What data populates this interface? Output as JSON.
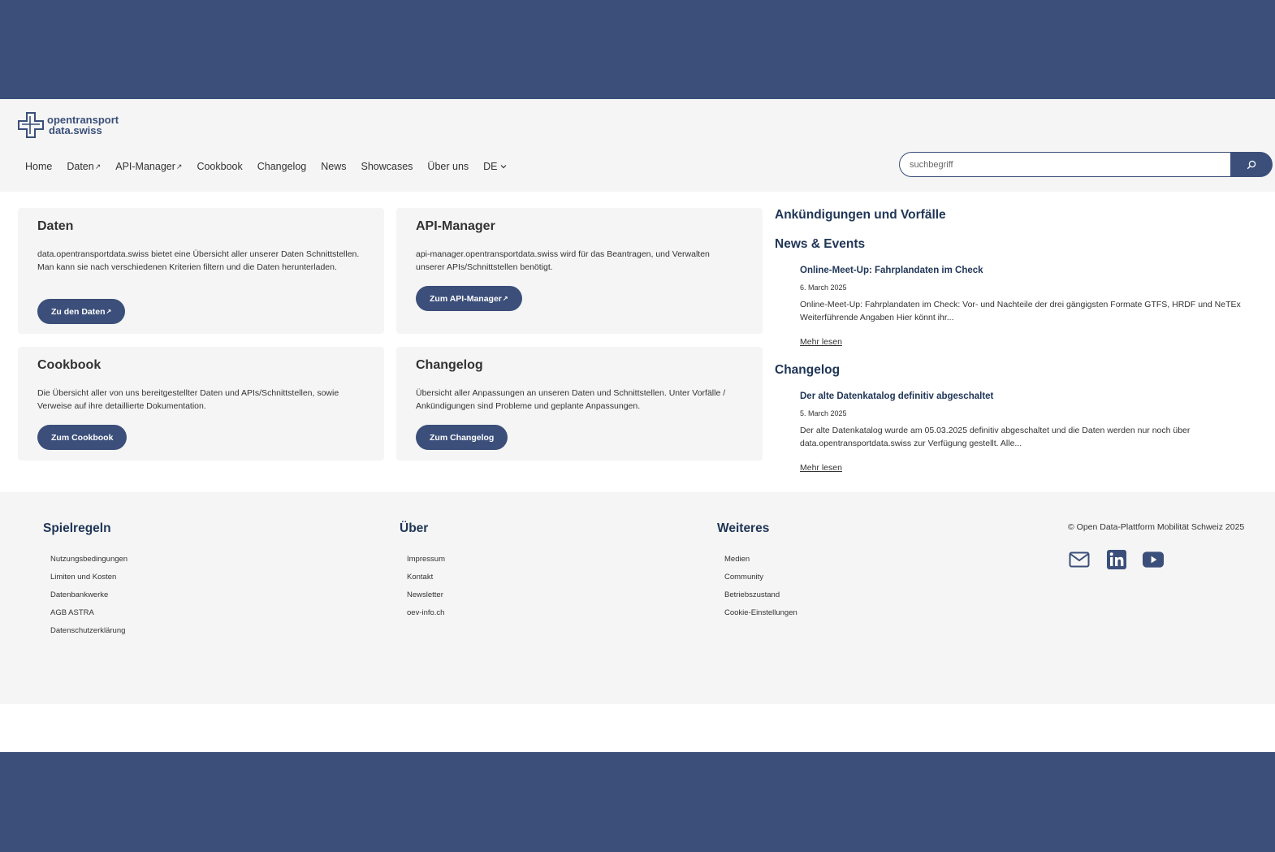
{
  "brand": {
    "logo_line1": "opentransport",
    "logo_line2": "data.swiss"
  },
  "nav": {
    "items": [
      {
        "label": "Home"
      },
      {
        "label": "Daten",
        "external": true
      },
      {
        "label": "API-Manager",
        "external": true
      },
      {
        "label": "Cookbook"
      },
      {
        "label": "Changelog"
      },
      {
        "label": "News"
      },
      {
        "label": "Showcases"
      },
      {
        "label": "Über uns"
      }
    ],
    "language": "DE",
    "external_glyph": "↗",
    "chevron_glyph": "⌄"
  },
  "search": {
    "placeholder": "suchbegriff",
    "button_icon": "search-icon"
  },
  "cards": [
    {
      "title": "Daten",
      "text": "data.opentransportdata.swiss bietet eine Übersicht aller unserer Daten Schnittstellen. Man kann sie nach verschiedenen Kriterien filtern und die Daten herunterladen.",
      "button": "Zu den Daten"
    },
    {
      "title": "API-Manager",
      "text": "api-manager.opentransportdata.swiss wird für das Beantragen, und Verwalten unserer APIs/Schnittstellen benötigt.",
      "button": "Zum API-Manager"
    },
    {
      "title": "Cookbook",
      "text": "Die Übersicht aller von uns bereitgestellter Daten und APIs/Schnittstellen, sowie Verweise auf ihre detaillierte Dokumentation.",
      "button": "Zum Cookbook"
    },
    {
      "title": "Changelog",
      "text": "Übersicht aller Anpassungen an unseren Daten und Schnittstellen. Unter Vorfälle / Ankündigungen sind Probleme und geplante Anpassungen.",
      "button": "Zum Changelog"
    }
  ],
  "sidebar": {
    "announcements_heading": "Ankündigungen und Vorfälle",
    "news_heading": "News & Events",
    "news_item": {
      "title": "Online-Meet-Up: Fahrplandaten im Check",
      "date": "6. March 2025",
      "text": "Online-Meet-Up: Fahrplandaten im Check: Vor- und Nachteile der drei gängigsten Formate GTFS, HRDF und NeTEx Weiterführende Angaben Hier könnt ihr...",
      "more": "Mehr lesen"
    },
    "changelog_heading": "Changelog",
    "changelog_item": {
      "title": "Der alte Datenkatalog definitiv abgeschaltet",
      "date": "5. March 2025",
      "text": "Der alte Datenkatalog wurde am 05.03.2025 definitiv abgeschaltet und die Daten werden nur noch über data.opentransportdata.swiss zur Verfügung gestellt. Alle...",
      "more": "Mehr lesen"
    }
  },
  "footer": {
    "columns": [
      {
        "heading": "Spielregeln",
        "links": [
          "Nutzungsbedingungen",
          "Limiten und Kosten",
          "Datenbankwerke",
          "AGB ASTRA",
          "Datenschutzerklärung"
        ]
      },
      {
        "heading": "Über",
        "links": [
          "Impressum",
          "Kontakt",
          "Newsletter",
          "oev-info.ch"
        ]
      },
      {
        "heading": "Weiteres",
        "links": [
          "Medien",
          "Community",
          "Betriebszustand",
          "Cookie-Einstellungen"
        ]
      }
    ],
    "copyright": "© Open Data-Plattform Mobilität Schweiz 2025",
    "social": [
      "mail-icon",
      "linkedin-icon",
      "youtube-icon"
    ]
  },
  "colors": {
    "brand_blue": "#3b4f7a",
    "heading_navy": "#1f3556",
    "panel_gray": "#f5f5f5"
  }
}
